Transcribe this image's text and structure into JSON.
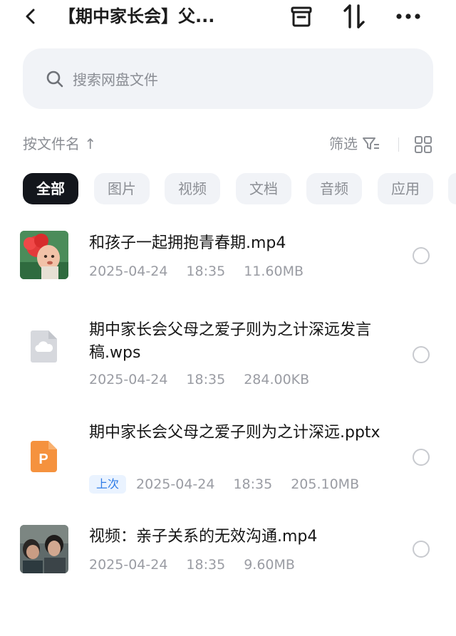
{
  "header": {
    "title": "【期中家长会】父..."
  },
  "search": {
    "placeholder": "搜索网盘文件"
  },
  "sortbar": {
    "sort_label": "按文件名 ↑",
    "filter_label": "筛选"
  },
  "chips": [
    "全部",
    "图片",
    "视频",
    "文档",
    "音频",
    "应用"
  ],
  "files": [
    {
      "name": "和孩子一起拥抱青春期.mp4",
      "date": "2025-04-24",
      "time": "18:35",
      "size": "11.60MB",
      "icon": "video-thumbnail"
    },
    {
      "name": "期中家长会父母之爱子则为之计深远发言稿.wps",
      "date": "2025-04-24",
      "time": "18:35",
      "size": "284.00KB",
      "icon": "cloud-file-icon"
    },
    {
      "name": "期中家长会父母之爱子则为之计深远.pptx",
      "date": "2025-04-24",
      "time": "18:35",
      "size": "205.10MB",
      "icon": "ppt-file-icon",
      "tag": "上次"
    },
    {
      "name": "视频：亲子关系的无效沟通.mp4",
      "date": "2025-04-24",
      "time": "18:35",
      "size": "9.60MB",
      "icon": "video-thumbnail"
    }
  ],
  "colors": {
    "active_chip": "#13161c",
    "chip_bg": "#f1f3f7",
    "tag_text": "#2e7be6",
    "ppt_orange": "#f5923e"
  }
}
